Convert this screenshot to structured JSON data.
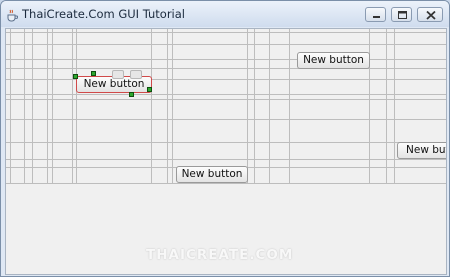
{
  "window": {
    "title": "ThaiCreate.Com GUI Tutorial",
    "controls": {
      "minimize": "minimize",
      "maximize": "maximize",
      "close": "close"
    }
  },
  "buttons": [
    {
      "label": "New button"
    },
    {
      "label": "New button"
    },
    {
      "label": "New button"
    },
    {
      "label": "New button"
    }
  ],
  "watermark": "THAICREATE.COM",
  "colors": {
    "selection_border": "#d04a4a",
    "handle": "#2ea82e",
    "grid_line": "#bdbdbd"
  }
}
